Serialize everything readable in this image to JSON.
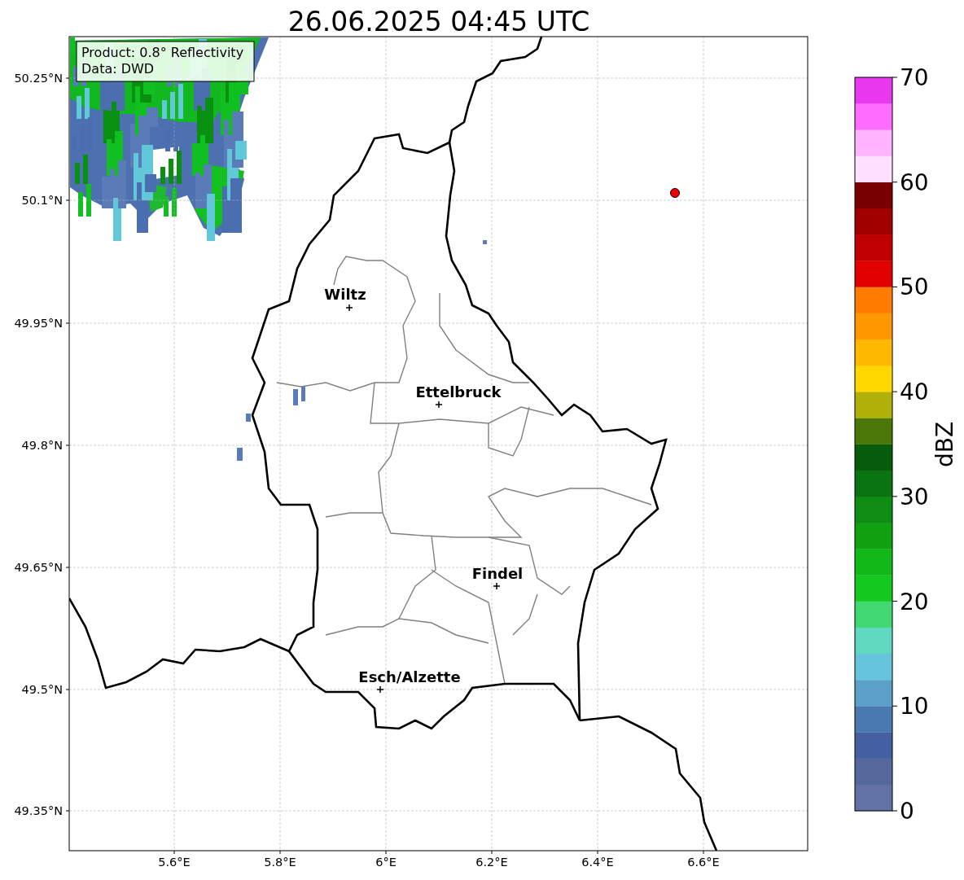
{
  "title": "26.06.2025 04:45 UTC",
  "info_box": [
    "Product: 0.8° Reflectivity",
    "Data: DWD"
  ],
  "cities": [
    {
      "name": "Wiltz"
    },
    {
      "name": "Ettelbruck"
    },
    {
      "name": "Findel"
    },
    {
      "name": "Esch/Alzette"
    }
  ],
  "x_axis": {
    "ticks": [
      "5.6°E",
      "5.8°E",
      "6°E",
      "6.2°E",
      "6.4°E",
      "6.6°E"
    ]
  },
  "y_axis": {
    "ticks": [
      "50.25°N",
      "50.1°N",
      "49.95°N",
      "49.8°N",
      "49.65°N",
      "49.5°N",
      "49.35°N"
    ]
  },
  "colorbar": {
    "label": "dBZ",
    "ticks": [
      "70",
      "60",
      "50",
      "40",
      "30",
      "20",
      "10",
      "0"
    ]
  }
}
